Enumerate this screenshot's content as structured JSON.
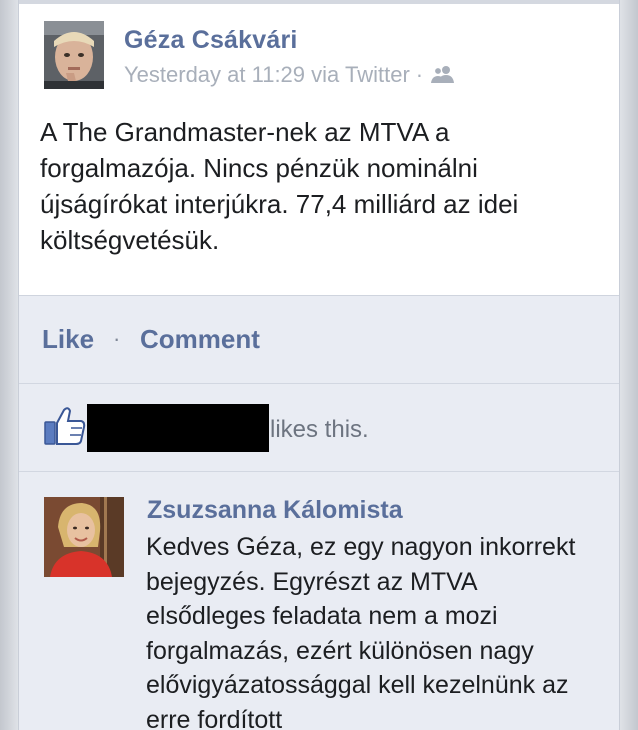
{
  "post": {
    "author": "Géza Csákvári",
    "timestamp": "Yesterday at 11:29 via Twitter",
    "separator": "·",
    "privacy_icon": "friends-icon",
    "text": "A The Grandmaster-nek az MTVA a forgalmazója. Nincs pénzük nominálni újságírókat interjúkra. 77,4 milliárd az idei költségvetésük."
  },
  "actions": {
    "like_label": "Like",
    "separator": "·",
    "comment_label": "Comment"
  },
  "likes": {
    "icon": "thumbs-up-icon",
    "suffix": "likes this."
  },
  "comment": {
    "author": "Zsuzsanna Kálomista",
    "text": "Kedves Géza, ez egy nagyon inkorrekt bejegyzés. Egyrészt az MTVA elsődleges feladata nem a mozi forgalmazás, ezért különösen nagy elővigyázatossággal kell kezelnünk az erre fordított"
  },
  "colors": {
    "link": "#5a6f9b",
    "meta": "#a8afba",
    "card_bg": "#e9ecf3",
    "post_bg": "#ffffff"
  }
}
